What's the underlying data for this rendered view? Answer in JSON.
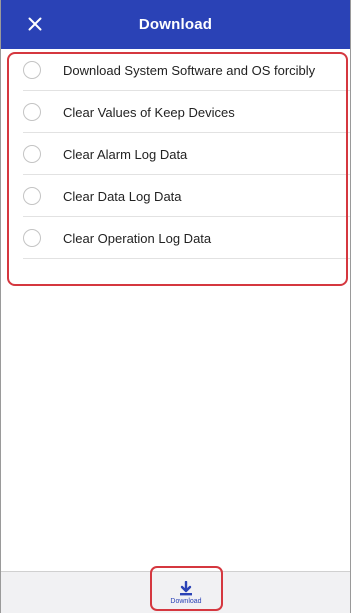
{
  "header": {
    "title": "Download",
    "close_icon": "close-icon"
  },
  "options": [
    {
      "label": "Download System Software and OS forcibly",
      "selected": false
    },
    {
      "label": "Clear Values of Keep Devices",
      "selected": false
    },
    {
      "label": "Clear Alarm Log Data",
      "selected": false
    },
    {
      "label": "Clear Data Log Data",
      "selected": false
    },
    {
      "label": "Clear Operation Log Data",
      "selected": false
    }
  ],
  "footer": {
    "download_label": "Download",
    "download_icon": "download-icon"
  },
  "colors": {
    "header_bg": "#2a42b6",
    "accent": "#2a42b6",
    "highlight": "#d5373f"
  }
}
